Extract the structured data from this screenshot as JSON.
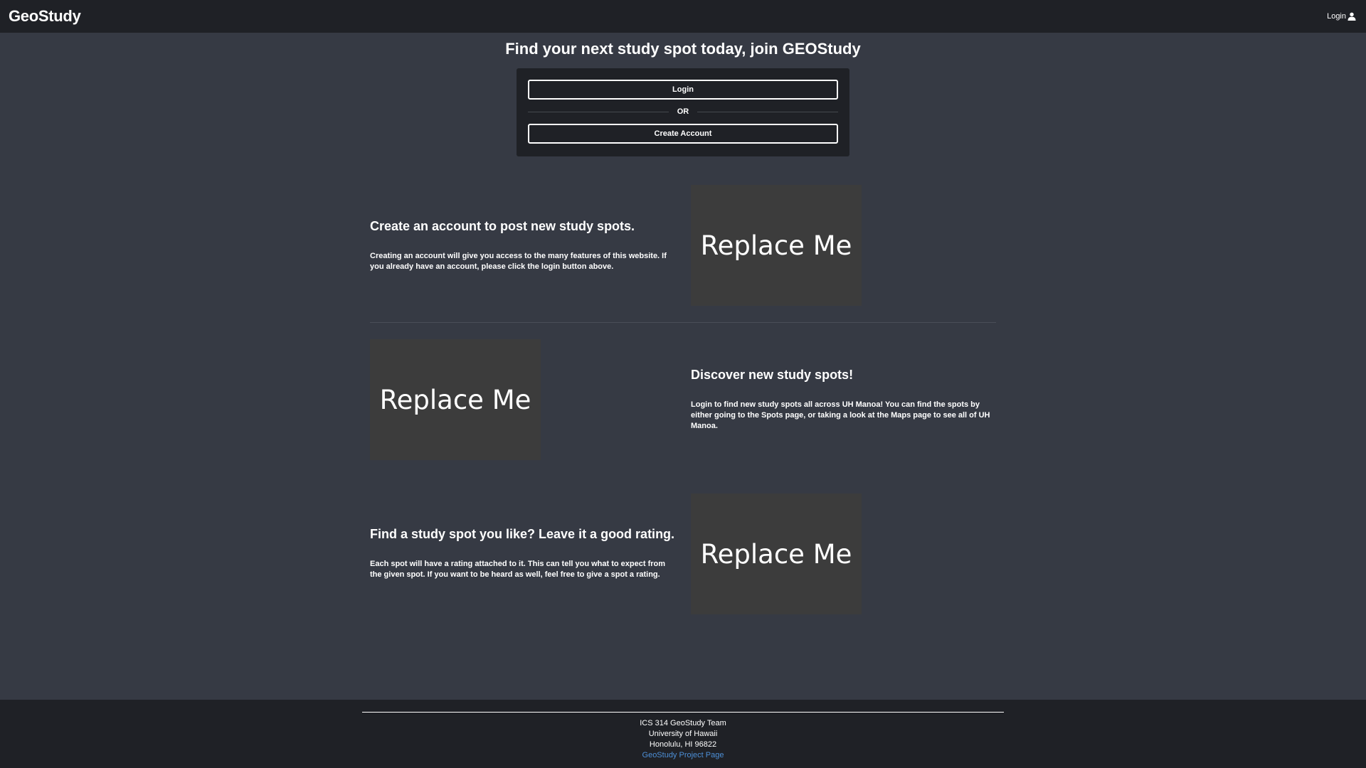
{
  "navbar": {
    "brand": "GeoStudy",
    "login_label": "Login",
    "login_icon": "user-icon"
  },
  "hero": {
    "title": "Find your next study spot today, join GEOStudy",
    "login_button": "Login",
    "or_text": "OR",
    "create_account_button": "Create Account"
  },
  "features": [
    {
      "title": "Create an account to post new study spots.",
      "body": "Creating an account will give you access to the many features of this website. If you already have an account, please click the login button above.",
      "image_text": "Replace Me"
    },
    {
      "title": "Discover new study spots!",
      "body": "Login to find new study spots all across UH Manoa! You can find the spots by either going to the Spots page, or taking a look at the Maps page to see all of UH Manoa.",
      "image_text": "Replace Me"
    },
    {
      "title": "Find a study spot you like? Leave it a good rating.",
      "body": "Each spot will have a rating attached to it. This can tell you what to expect from the given spot. If you want to be heard as well, feel free to give a spot a rating.",
      "image_text": "Replace Me"
    }
  ],
  "footer": {
    "line1": "ICS 314 GeoStudy Team",
    "line2": "University of Hawaii",
    "line3": "Honolulu, HI 96822",
    "link_text": "GeoStudy Project Page"
  },
  "colors": {
    "page_background": "#363a44",
    "bar_background": "#1f2126",
    "placeholder": "#3c3c3c",
    "link": "#4d8fd6"
  }
}
